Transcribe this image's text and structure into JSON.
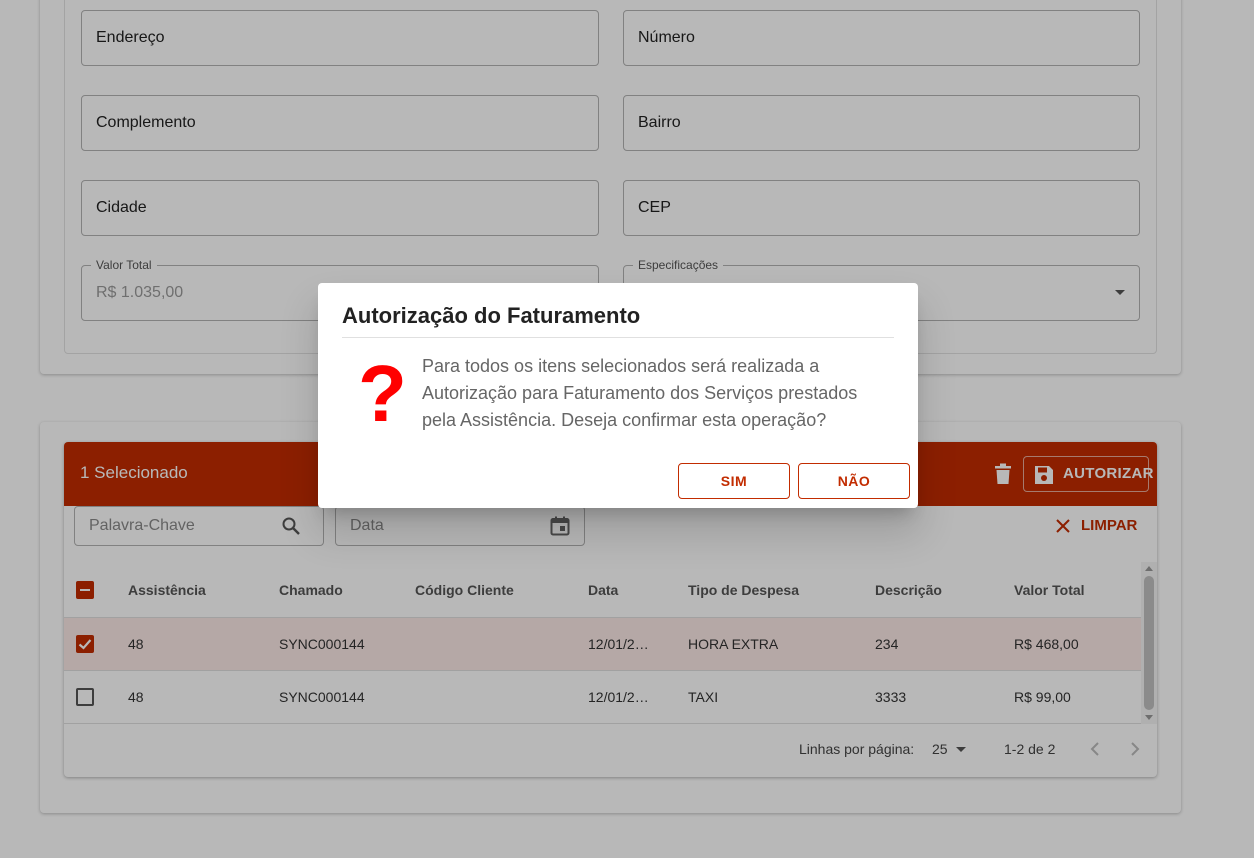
{
  "form": {
    "endereco": "Endereço",
    "numero": "Número",
    "complemento": "Complemento",
    "bairro": "Bairro",
    "cidade": "Cidade",
    "cep": "CEP",
    "valor_total_label": "Valor Total",
    "valor_total_value": "R$ 1.035,00",
    "especificacoes_label": "Especificações"
  },
  "toolbar": {
    "selected_count": "1 Selecionado",
    "autorizar_label": "AUTORIZAR"
  },
  "filters": {
    "keyword_placeholder": "Palavra-Chave",
    "date_placeholder": "Data",
    "limpar_label": "LIMPAR"
  },
  "table": {
    "columns": [
      "Assistência",
      "Chamado",
      "Código Cliente",
      "Data",
      "Tipo de Despesa",
      "Descrição",
      "Valor Total"
    ],
    "rows": [
      {
        "selected": true,
        "assistencia": "48",
        "chamado": "SYNC000144",
        "codigo_cliente": "",
        "data": "12/01/2…",
        "tipo": "HORA EXTRA",
        "descricao": "234",
        "valor": "R$ 468,00"
      },
      {
        "selected": false,
        "assistencia": "48",
        "chamado": "SYNC000144",
        "codigo_cliente": "",
        "data": "12/01/2…",
        "tipo": "TAXI",
        "descricao": "3333",
        "valor": "R$ 99,00"
      }
    ]
  },
  "pagination": {
    "rows_per_page_label": "Linhas por página:",
    "rows_per_page": "25",
    "range": "1-2 de 2"
  },
  "dialog": {
    "title": "Autorização do Faturamento",
    "icon": "?",
    "message": "Para todos os itens selecionados será realizada a Autorização para Faturamento dos Serviços prestados pela Assistência. Deseja confirmar esta operação?",
    "confirm_label": "SIM",
    "cancel_label": "NÃO"
  },
  "colors": {
    "accent": "#c22c00",
    "question_icon": "#ff0000"
  }
}
